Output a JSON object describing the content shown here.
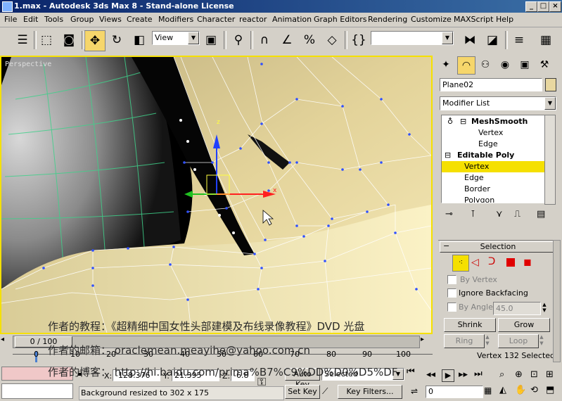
{
  "window": {
    "title": "1.max - Autodesk 3ds Max 8 - Stand-alone License",
    "buttons": [
      "_",
      "□",
      "×"
    ]
  },
  "menu": [
    "File",
    "Edit",
    "Tools",
    "Group",
    "Views",
    "Create",
    "Modifiers",
    "Character",
    "reactor",
    "Animation",
    "Graph Editors",
    "Rendering",
    "Customize",
    "MAXScript",
    "Help"
  ],
  "toolbar": {
    "ref_coord": "View",
    "named_selection": ""
  },
  "viewport": {
    "label": "Perspective",
    "gizmo_x": "x",
    "gizmo_z": "z"
  },
  "overlay": {
    "line1": "作者的教程：《超精细中国女性头部建模及布线录像教程》DVD 光盘",
    "line2": "作者的邮箱：  oraclemean.meayihe@yahoo.com.cn",
    "line3": "作者的博客：  http://hi.baidu.com/prima%B7%C9%DD%D0%D5%DF"
  },
  "command_panel": {
    "object_name": "Plane02",
    "modifier_list": "Modifier List",
    "stack": [
      {
        "label": "MeshSmooth",
        "bold": true,
        "indent": 0
      },
      {
        "label": "Vertex",
        "bold": false,
        "indent": 1
      },
      {
        "label": "Edge",
        "bold": false,
        "indent": 1
      },
      {
        "label": "Editable Poly",
        "bold": true,
        "indent": 0
      },
      {
        "label": "Vertex",
        "bold": false,
        "indent": 1
      },
      {
        "label": "Edge",
        "bold": false,
        "indent": 1
      },
      {
        "label": "Border",
        "bold": false,
        "indent": 1
      },
      {
        "label": "Polygon",
        "bold": false,
        "indent": 1
      }
    ],
    "selection_title": "Selection",
    "by_vertex": "By Vertex",
    "ignore_backfacing": "Ignore Backfacing",
    "by_angle": "By Angle:",
    "by_angle_value": "45.0",
    "shrink": "Shrink",
    "grow": "Grow",
    "ring": "Ring",
    "loop": "Loop",
    "status": "Vertex 132 Selected"
  },
  "timeline": {
    "frame": "0 / 100",
    "ticks": [
      "0",
      "10",
      "20",
      "30",
      "40",
      "50",
      "60",
      "70",
      "80",
      "90",
      "100"
    ]
  },
  "status": {
    "x": "-128.376",
    "y": "21.395",
    "z": "-6.8",
    "x_label": "X:",
    "y_label": "Y:",
    "z_label": "Z:",
    "prompt": "Background resized to 302 x 175",
    "auto_key": "Auto Key",
    "set_key": "Set Key",
    "selected": "Selected",
    "key_filters": "Key Filters...",
    "frame_field": "0"
  },
  "colors": {
    "titlebar": "#0a246a",
    "selection_highlight": "#f5e000",
    "mesh_color": "#e8d7a0"
  }
}
